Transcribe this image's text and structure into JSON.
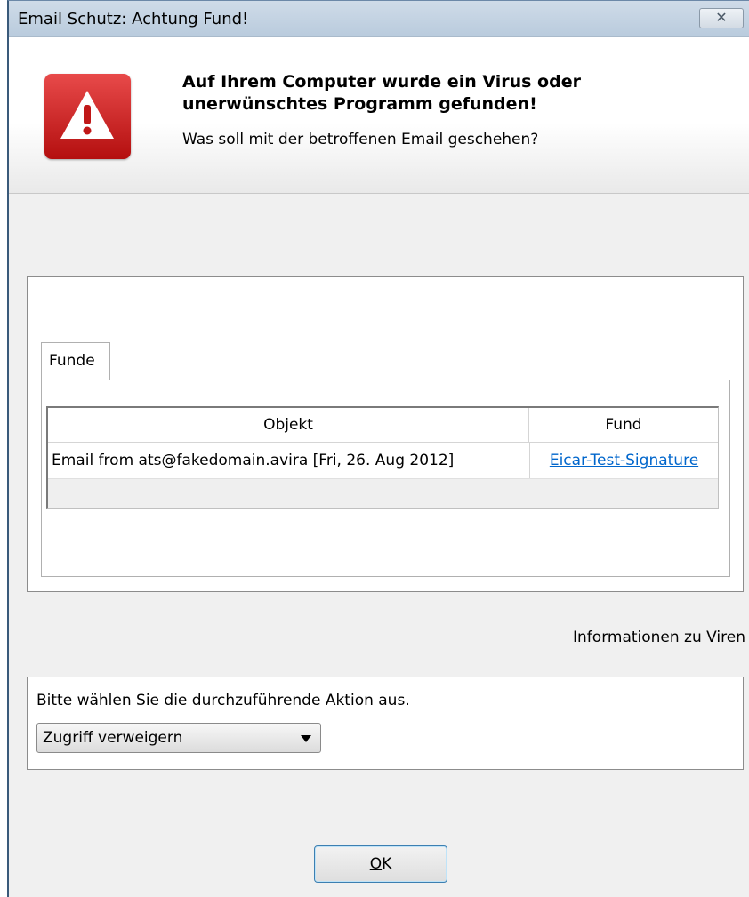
{
  "window": {
    "title": "Email Schutz: Achtung Fund!",
    "close_glyph": "✕"
  },
  "header": {
    "headline": "Auf Ihrem Computer wurde ein Virus oder unerwünschtes Programm gefunden!",
    "question": "Was soll mit der betroffenen Email geschehen?",
    "icon": "warning-icon",
    "icon_color": "#d42424"
  },
  "findings": {
    "tab_label": "Funde",
    "columns": [
      "Objekt",
      "Fund"
    ],
    "rows": [
      {
        "object": "Email from ats@fakedomain.avira [Fri, 26. Aug 2012]",
        "finding": "Eicar-Test-Signature"
      }
    ]
  },
  "virus_info_label": "Informationen zu Viren",
  "action": {
    "label": "Bitte wählen Sie die durchzuführende Aktion aus.",
    "selected": "Zugriff verweigern"
  },
  "ok_button": {
    "label_prefix": "",
    "accel": "O",
    "label_rest": "K"
  }
}
